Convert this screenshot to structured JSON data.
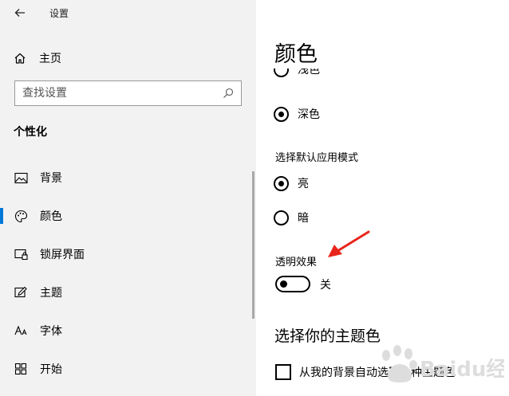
{
  "window": {
    "title": "设置"
  },
  "sidebar": {
    "home_label": "主页",
    "search_placeholder": "查找设置",
    "section_title": "个性化",
    "items": [
      {
        "label": "背景",
        "icon": "picture-icon",
        "active": false
      },
      {
        "label": "颜色",
        "icon": "palette-icon",
        "active": true
      },
      {
        "label": "锁屏界面",
        "icon": "lock-screen-icon",
        "active": false
      },
      {
        "label": "主题",
        "icon": "theme-icon",
        "active": false
      },
      {
        "label": "字体",
        "icon": "font-icon",
        "active": false
      },
      {
        "label": "开始",
        "icon": "start-icon",
        "active": false
      }
    ]
  },
  "main": {
    "title": "颜色",
    "windows_mode": {
      "options": [
        {
          "label": "浅色",
          "checked": false
        },
        {
          "label": "深色",
          "checked": true
        }
      ]
    },
    "app_mode": {
      "label": "选择默认应用模式",
      "options": [
        {
          "label": "亮",
          "checked": true
        },
        {
          "label": "暗",
          "checked": false
        }
      ]
    },
    "transparency": {
      "label": "透明效果",
      "state_label": "关",
      "on": false
    },
    "accent": {
      "heading": "选择你的主题色",
      "auto_checkbox_label": "从我的背景自动选取一种主题色",
      "auto_checked": false
    }
  },
  "colors": {
    "sidebar_bg": "#f2f2f2",
    "accent": "#0078d7",
    "annotation_arrow": "#e8251b"
  },
  "watermark": {
    "text": "Baidu经验",
    "color": "#dddddd"
  }
}
